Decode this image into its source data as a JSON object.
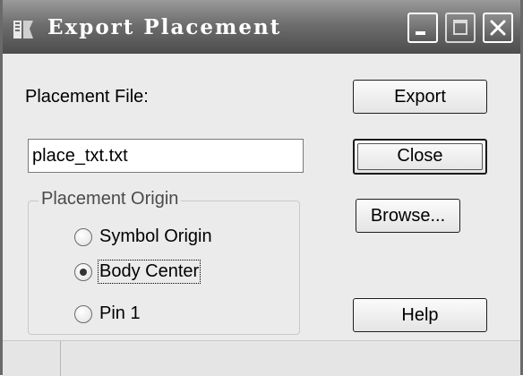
{
  "window": {
    "title": "Export Placement"
  },
  "labels": {
    "placement_file": "Placement File:"
  },
  "inputs": {
    "placement_file_value": "place_txt.txt"
  },
  "buttons": {
    "export": "Export",
    "close": "Close",
    "browse": "Browse...",
    "help": "Help"
  },
  "placement_origin": {
    "title": "Placement Origin",
    "options": [
      {
        "label": "Symbol Origin",
        "selected": false
      },
      {
        "label": "Body Center",
        "selected": true
      },
      {
        "label": "Pin 1",
        "selected": false
      }
    ]
  },
  "icons": {
    "app": "export-placement-app-icon",
    "minimize": "minimize-icon",
    "maximize": "maximize-icon",
    "close": "close-icon"
  }
}
